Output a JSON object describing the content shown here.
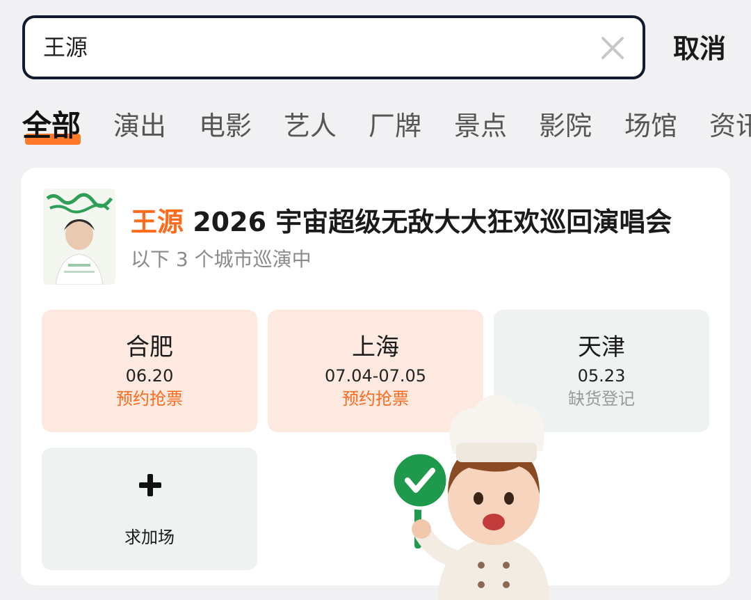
{
  "search": {
    "query": "王源",
    "clear_icon": "close-icon",
    "cancel_label": "取消"
  },
  "tabs": [
    {
      "label": "全部",
      "active": true
    },
    {
      "label": "演出"
    },
    {
      "label": "电影"
    },
    {
      "label": "艺人"
    },
    {
      "label": "厂牌"
    },
    {
      "label": "景点"
    },
    {
      "label": "影院"
    },
    {
      "label": "场馆"
    },
    {
      "label": "资讯"
    }
  ],
  "colors": {
    "accent": "#ff6a1c",
    "tab_underline": "#ff7a2a",
    "hot_tile": "#fde9df",
    "muted_tile": "#eef2f1",
    "search_border": "#141a2e"
  },
  "result": {
    "poster_icon": "concert-poster-image",
    "title_artist": "王源",
    "title_rest": " 2026 宇宙超级无敌大大狂欢巡回演唱会",
    "subtitle": "以下 3 个城市巡演中",
    "cities": [
      {
        "name": "合肥",
        "date": "06.20",
        "status": "预约抢票",
        "state": "hot"
      },
      {
        "name": "上海",
        "date": "07.04-07.05",
        "status": "预约抢票",
        "state": "hot"
      },
      {
        "name": "天津",
        "date": "05.23",
        "status": "缺货登记",
        "state": "muted"
      }
    ],
    "add_show": {
      "icon": "plus-icon",
      "label": "求加场"
    }
  },
  "sticker": {
    "icon": "chef-mascot-checkmark-sign"
  }
}
